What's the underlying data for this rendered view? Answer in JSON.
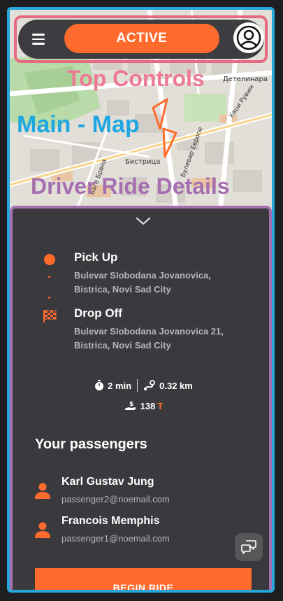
{
  "top_controls": {
    "status_label": "ACTIVE",
    "menu_icon": "hamburger-menu-icon",
    "profile_icon": "user-profile-icon"
  },
  "annotations": {
    "top": "Top Controls",
    "map": "Main - Map",
    "details": "Driver Ride Details"
  },
  "map": {
    "labels": {
      "district": "Бистрица",
      "street_left": "Баге Брвна",
      "street_right": "Булевар Европе",
      "top_right": "Детелинара",
      "top_right_2": "Хаџи Рувим"
    }
  },
  "ride": {
    "pickup": {
      "title": "Pick Up",
      "address": "Bulevar Slobodana Jovanovica, Bistrica, Novi Sad City"
    },
    "dropoff": {
      "title": "Drop Off",
      "address": "Bulevar Slobodana Jovanovica 21, Bistrica, Novi Sad City"
    },
    "duration": "2 min",
    "distance": "0.32 km",
    "price": "138",
    "currency": "T"
  },
  "passengers": {
    "title": "Your passengers",
    "list": [
      {
        "name": "Karl Gustav Jung",
        "email": "passenger2@noemail.com"
      },
      {
        "name": "Francois Memphis",
        "email": "passenger1@noemail.com"
      }
    ]
  },
  "actions": {
    "begin_label": "BEGIN RIDE"
  },
  "colors": {
    "accent": "#ff6b2c",
    "panel": "#3a393d",
    "frame": "#25a7dc",
    "top_outline": "#e66a82",
    "details_outline": "#a56fb0"
  }
}
